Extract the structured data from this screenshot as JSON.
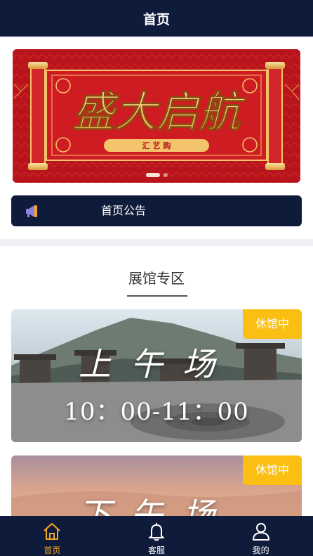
{
  "header": {
    "title": "首页"
  },
  "banner": {
    "title": "盛大启航",
    "subtitle": "汇 艺 购",
    "colors": {
      "background": "#b8141b",
      "gold": "#f3c46b"
    },
    "slide_count": 2,
    "active_slide": 1
  },
  "notice": {
    "label": "首页公告",
    "icon": "megaphone-icon"
  },
  "section": {
    "title": "展馆专区"
  },
  "venues": [
    {
      "badge": "休馆中",
      "title": "上午场",
      "time": "10：00-11：00"
    },
    {
      "badge": "休馆中",
      "title": "下午场"
    }
  ],
  "tabbar": {
    "items": [
      {
        "label": "首页",
        "icon": "home-icon",
        "active": true
      },
      {
        "label": "客服",
        "icon": "bell-icon",
        "active": false
      },
      {
        "label": "我的",
        "icon": "user-icon",
        "active": false
      }
    ],
    "colors": {
      "active": "#f5a623",
      "inactive": "#ffffff",
      "background": "#0f1b3a"
    }
  }
}
